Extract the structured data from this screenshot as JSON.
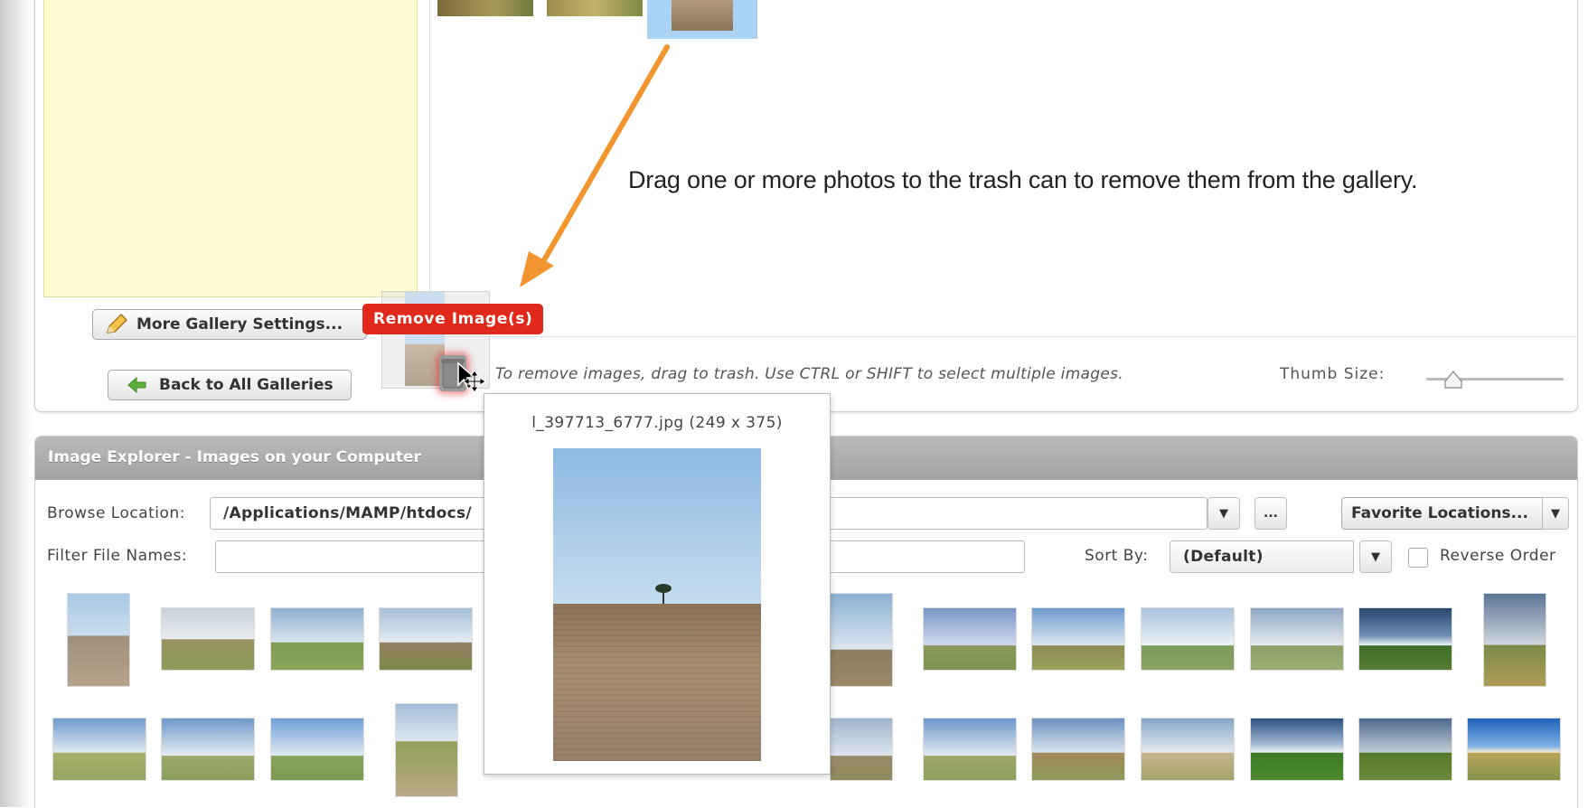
{
  "gallery": {
    "more_settings_label": "More Gallery Settings...",
    "back_label": "Back to All Galleries",
    "instruction": "Drag one or more photos to the trash can to remove them from the gallery.",
    "remove_badge": "Remove Image(s)",
    "hint": "To remove images, drag to trash.  Use CTRL or SHIFT to select multiple images.",
    "thumb_size_label": "Thumb Size:",
    "thumb_size_value": 0.2
  },
  "explorer": {
    "title": "Image Explorer - Images on your Computer",
    "browse_label": "Browse Location:",
    "browse_value": "/Applications/MAMP/htdocs/",
    "browse_button": "...",
    "favorites_label": "Favorite Locations...",
    "filter_label": "Filter File Names:",
    "filter_value": "",
    "sort_label": "Sort By:",
    "sort_value": "(Default)",
    "reverse_label": "Reverse Order",
    "reverse_checked": false
  },
  "preview": {
    "caption": "l_397713_6777.jpg (249 x 375)"
  },
  "colors": {
    "accent_orange": "#f2952e",
    "remove_red": "#e0281b",
    "panel_yellow": "#fffbd0",
    "selection_blue": "#a9d2f3"
  }
}
